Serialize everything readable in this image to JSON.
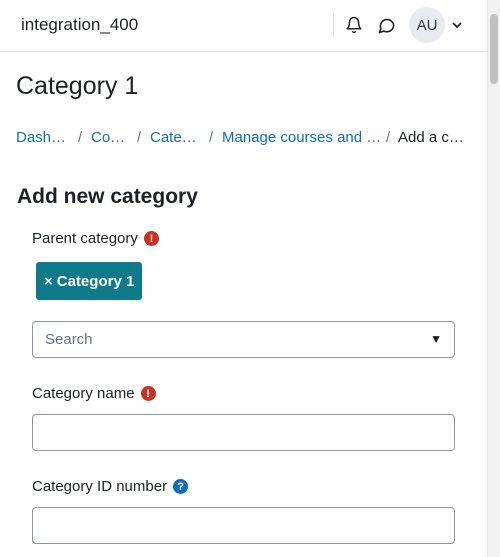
{
  "navbar": {
    "site_name": "integration_400",
    "avatar_initials": "AU"
  },
  "page": {
    "title": "Category 1"
  },
  "breadcrumb": {
    "items": [
      {
        "label": "Dash…"
      },
      {
        "label": "Co…"
      },
      {
        "label": "Cate…"
      },
      {
        "label": "Manage courses and …"
      },
      {
        "label": "Add a c…"
      }
    ],
    "separator": "/"
  },
  "form": {
    "heading": "Add new category",
    "parent_category": {
      "label": "Parent category",
      "required_icon": "!",
      "selected_chip": "Category 1",
      "chip_remove": "×",
      "search_placeholder": "Search",
      "dropdown_arrow": "▼"
    },
    "category_name": {
      "label": "Category name",
      "required_icon": "!",
      "value": ""
    },
    "category_id_number": {
      "label": "Category ID number",
      "help_icon": "?",
      "value": ""
    }
  },
  "colors": {
    "link": "#0f6cbf",
    "required": "#ca3120",
    "chip": "#0f7a8a",
    "help": "#0f6cbf"
  }
}
